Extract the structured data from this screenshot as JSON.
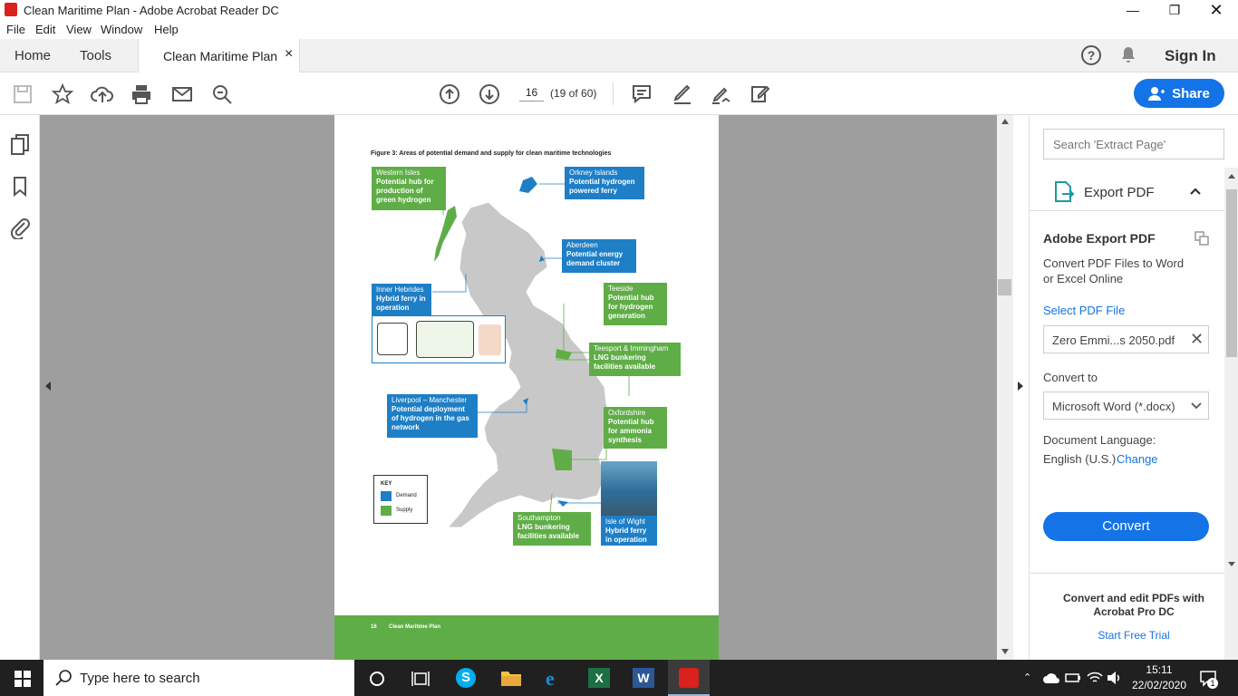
{
  "window": {
    "title": "Clean Maritime Plan - Adobe Acrobat Reader DC"
  },
  "menu": [
    "File",
    "Edit",
    "View",
    "Window",
    "Help"
  ],
  "tabs": {
    "home": "Home",
    "tools": "Tools",
    "document": "Clean Maritime Plan",
    "close": "×"
  },
  "header": {
    "help": "?",
    "sign_in": "Sign In"
  },
  "toolbar": {
    "page_current": "16",
    "page_info": "(19 of 60)",
    "share": "Share"
  },
  "document": {
    "figure_title": "Figure 3: Areas of potential demand and supply for clean maritime technologies",
    "labels": [
      {
        "name": "Western Isles",
        "text": "Potential hub for production of green hydrogen",
        "kind": "supply"
      },
      {
        "name": "Orkney Islands",
        "text": "Potential hydrogen powered ferry",
        "kind": "demand"
      },
      {
        "name": "Aberdeen",
        "text": "Potential energy demand cluster",
        "kind": "demand"
      },
      {
        "name": "Inner Hebrides",
        "text": "Hybrid ferry in operation",
        "kind": "demand"
      },
      {
        "name": "Teeside",
        "text": "Potential hub for hydrogen generation",
        "kind": "supply"
      },
      {
        "name": "Teesport & Immingham",
        "text": "LNG bunkering facilities available",
        "kind": "supply"
      },
      {
        "name": "Liverpool – Manchester",
        "text": "Potential deployment of hydrogen in the gas network",
        "kind": "demand"
      },
      {
        "name": "Oxfordshire",
        "text": "Potential hub for ammonia synthesis",
        "kind": "supply"
      },
      {
        "name": "Southampton",
        "text": "LNG bunkering facilities available",
        "kind": "supply"
      },
      {
        "name": "Isle of Wight",
        "text": "Hybrid ferry in operation",
        "kind": "demand"
      }
    ],
    "key": {
      "title": "KEY",
      "demand": "Demand",
      "supply": "Supply"
    },
    "footer": {
      "page": "16",
      "title": "Clean Maritime Plan"
    },
    "colors": {
      "demand": "#1e7fc6",
      "supply": "#5fad47",
      "map": "#c8c8c8"
    }
  },
  "right_panel": {
    "search_placeholder": "Search 'Extract Page'",
    "export_header": "Export PDF",
    "section_title": "Adobe Export PDF",
    "description": "Convert PDF Files to Word or Excel Online",
    "select_file": "Select PDF File",
    "file_name": "Zero Emmi...s 2050.pdf",
    "convert_to_label": "Convert to",
    "convert_to_value": "Microsoft Word (*.docx)",
    "language_label": "Document Language:",
    "language_value": "English (U.S.)",
    "change": "Change",
    "convert_button": "Convert",
    "promo": "Convert and edit PDFs with Acrobat Pro DC",
    "trial": "Start Free Trial"
  },
  "taskbar": {
    "search_placeholder": "Type here to search",
    "time": "15:11",
    "date": "22/02/2020",
    "notifications": "1"
  }
}
